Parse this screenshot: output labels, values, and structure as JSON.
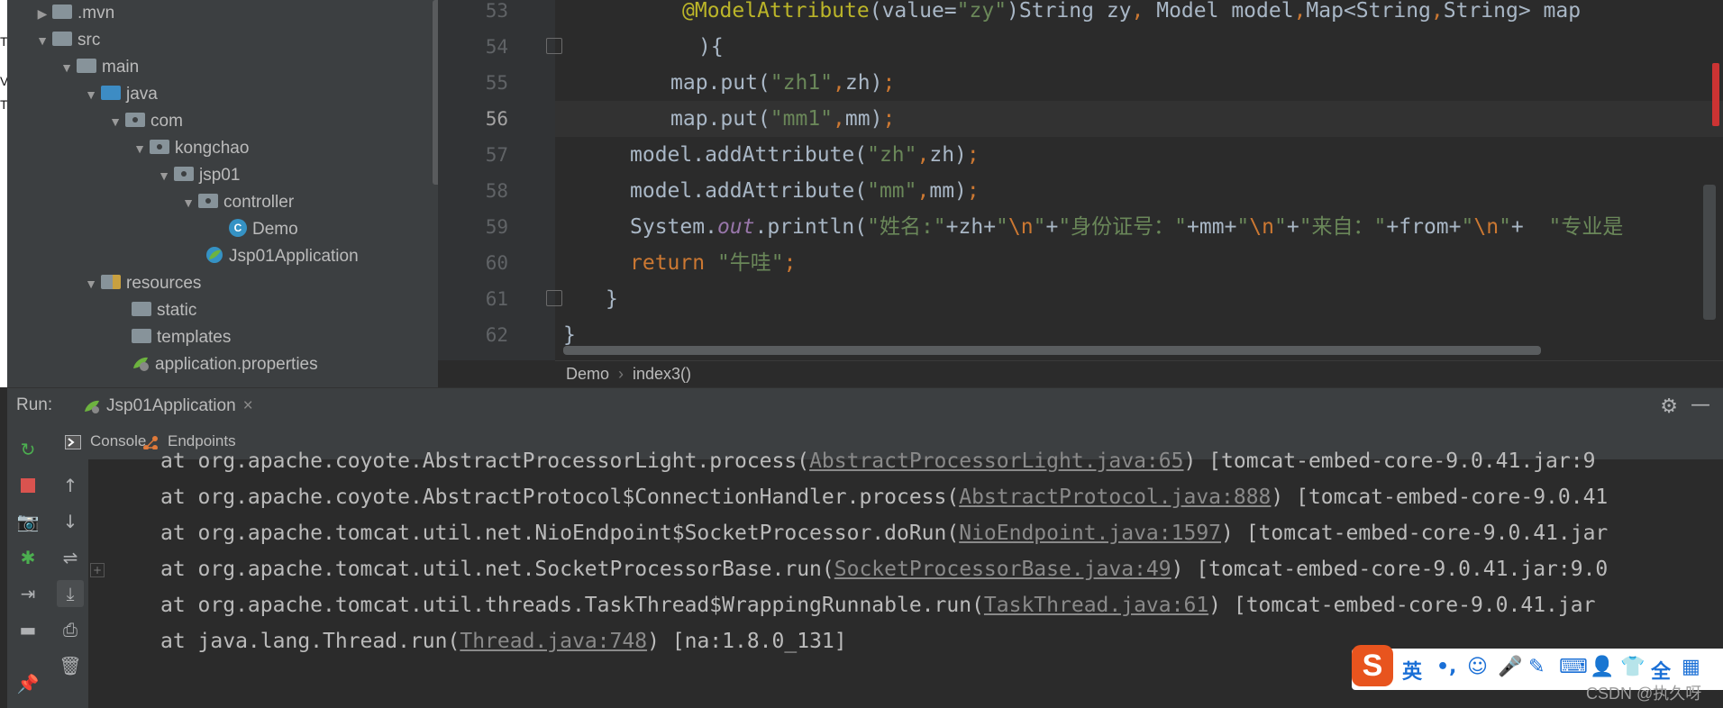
{
  "left_strip": {
    "chars": [
      "T",
      "V",
      "T"
    ]
  },
  "project_tree": {
    "items": [
      {
        "label": ".mvn",
        "arrow": "▶",
        "icon": "folder-icon"
      },
      {
        "label": "src",
        "arrow": "▼",
        "icon": "folder-icon"
      },
      {
        "label": "main",
        "arrow": "▼",
        "icon": "folder-icon"
      },
      {
        "label": "java",
        "arrow": "▼",
        "icon": "source-folder-icon"
      },
      {
        "label": "com",
        "arrow": "▼",
        "icon": "package-icon"
      },
      {
        "label": "kongchao",
        "arrow": "▼",
        "icon": "package-icon"
      },
      {
        "label": "jsp01",
        "arrow": "▼",
        "icon": "package-icon"
      },
      {
        "label": "controller",
        "arrow": "▼",
        "icon": "package-icon"
      },
      {
        "label": "Demo",
        "arrow": "",
        "icon": "class-icon"
      },
      {
        "label": "Jsp01Application",
        "arrow": "",
        "icon": "spring-class-icon"
      },
      {
        "label": "resources",
        "arrow": "▼",
        "icon": "resources-folder-icon"
      },
      {
        "label": "static",
        "arrow": "",
        "icon": "folder-icon"
      },
      {
        "label": "templates",
        "arrow": "",
        "icon": "folder-icon"
      },
      {
        "label": "application.properties",
        "arrow": "",
        "icon": "spring-properties-icon"
      }
    ],
    "class_badge": "C"
  },
  "editor": {
    "line_numbers": [
      "53",
      "54",
      "55",
      "56",
      "57",
      "58",
      "59",
      "60",
      "61",
      "62"
    ],
    "current_line": "56",
    "breadcrumb": [
      "Demo",
      "index3()"
    ],
    "breadcrumb_sep": "›"
  },
  "run_panel": {
    "label": "Run:",
    "tab": "Jsp01Application",
    "close": "×",
    "subtabs": [
      "Console",
      "Endpoints"
    ],
    "console_lines": [
      {
        "prefix": "at org.apache.coyote.AbstractProcessorLight.process(",
        "link": "AbstractProcessorLight.java:65",
        "suffix": ") [tomcat-embed-core-9.0.41.jar:9"
      },
      {
        "prefix": "at org.apache.coyote.AbstractProtocol$ConnectionHandler.process(",
        "link": "AbstractProtocol.java:888",
        "suffix": ") [tomcat-embed-core-9.0.41"
      },
      {
        "prefix": "at org.apache.tomcat.util.net.NioEndpoint$SocketProcessor.doRun(",
        "link": "NioEndpoint.java:1597",
        "suffix": ") [tomcat-embed-core-9.0.41.jar"
      },
      {
        "prefix": "at org.apache.tomcat.util.net.SocketProcessorBase.run(",
        "link": "SocketProcessorBase.java:49",
        "suffix": ") [tomcat-embed-core-9.0.41.jar:9.0"
      },
      {
        "prefix": "at org.apache.tomcat.util.threads.TaskThread$WrappingRunnable.run(",
        "link": "TaskThread.java:61",
        "suffix": ") [tomcat-embed-core-9.0.41.jar"
      },
      {
        "prefix": "at java.lang.Thread.run(",
        "link": "Thread.java:748",
        "suffix": ") [na:1.8.0_131]"
      }
    ]
  },
  "ime": {
    "logo": "S",
    "lang": "英",
    "punct": "•,",
    "icons": [
      "☺",
      "🎤",
      "✎",
      "⌨",
      "👤",
      "👕",
      "全",
      "▦"
    ]
  },
  "watermark": "CSDN @执久呀",
  "colors": {
    "string": "#6a8759",
    "keyword": "#cc7832",
    "annotation": "#bbb529",
    "field": "#9876aa"
  }
}
